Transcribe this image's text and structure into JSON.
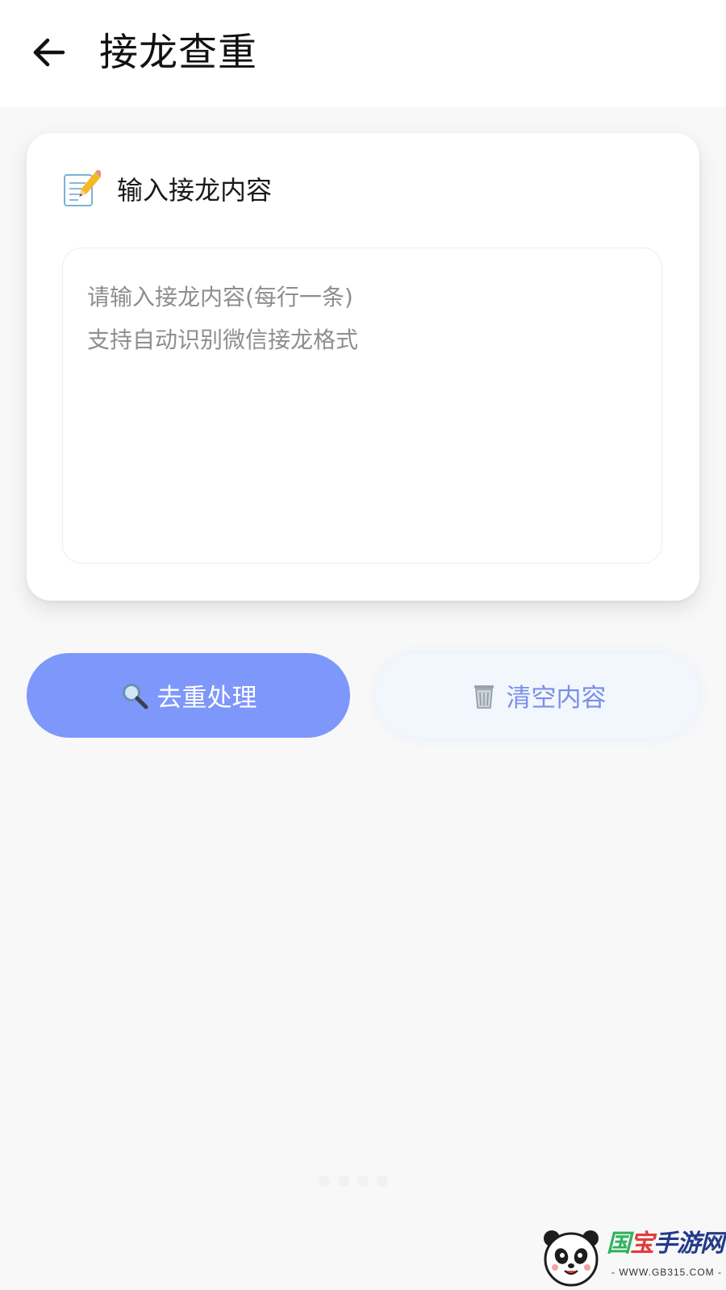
{
  "app_bar": {
    "title": "接龙查重",
    "back_icon": "arrow-left-icon"
  },
  "input_card": {
    "icon": "memo-pencil-icon",
    "title": "输入接龙内容",
    "textarea": {
      "value": "",
      "placeholder": "请输入接龙内容(每行一条)\n支持自动识别微信接龙格式"
    }
  },
  "actions": {
    "dedupe": {
      "icon": "magnifier-icon",
      "label": "去重处理",
      "color": "#7e97fb"
    },
    "clear": {
      "icon": "trash-can-icon",
      "label": "清空内容",
      "color": "#7b8fe8"
    }
  },
  "watermark": {
    "name": "国宝手游网",
    "url": "- WWW.GB315.COM -"
  },
  "colors": {
    "background": "#f8f8f9",
    "card": "#ffffff",
    "accent": "#7e97fb"
  }
}
